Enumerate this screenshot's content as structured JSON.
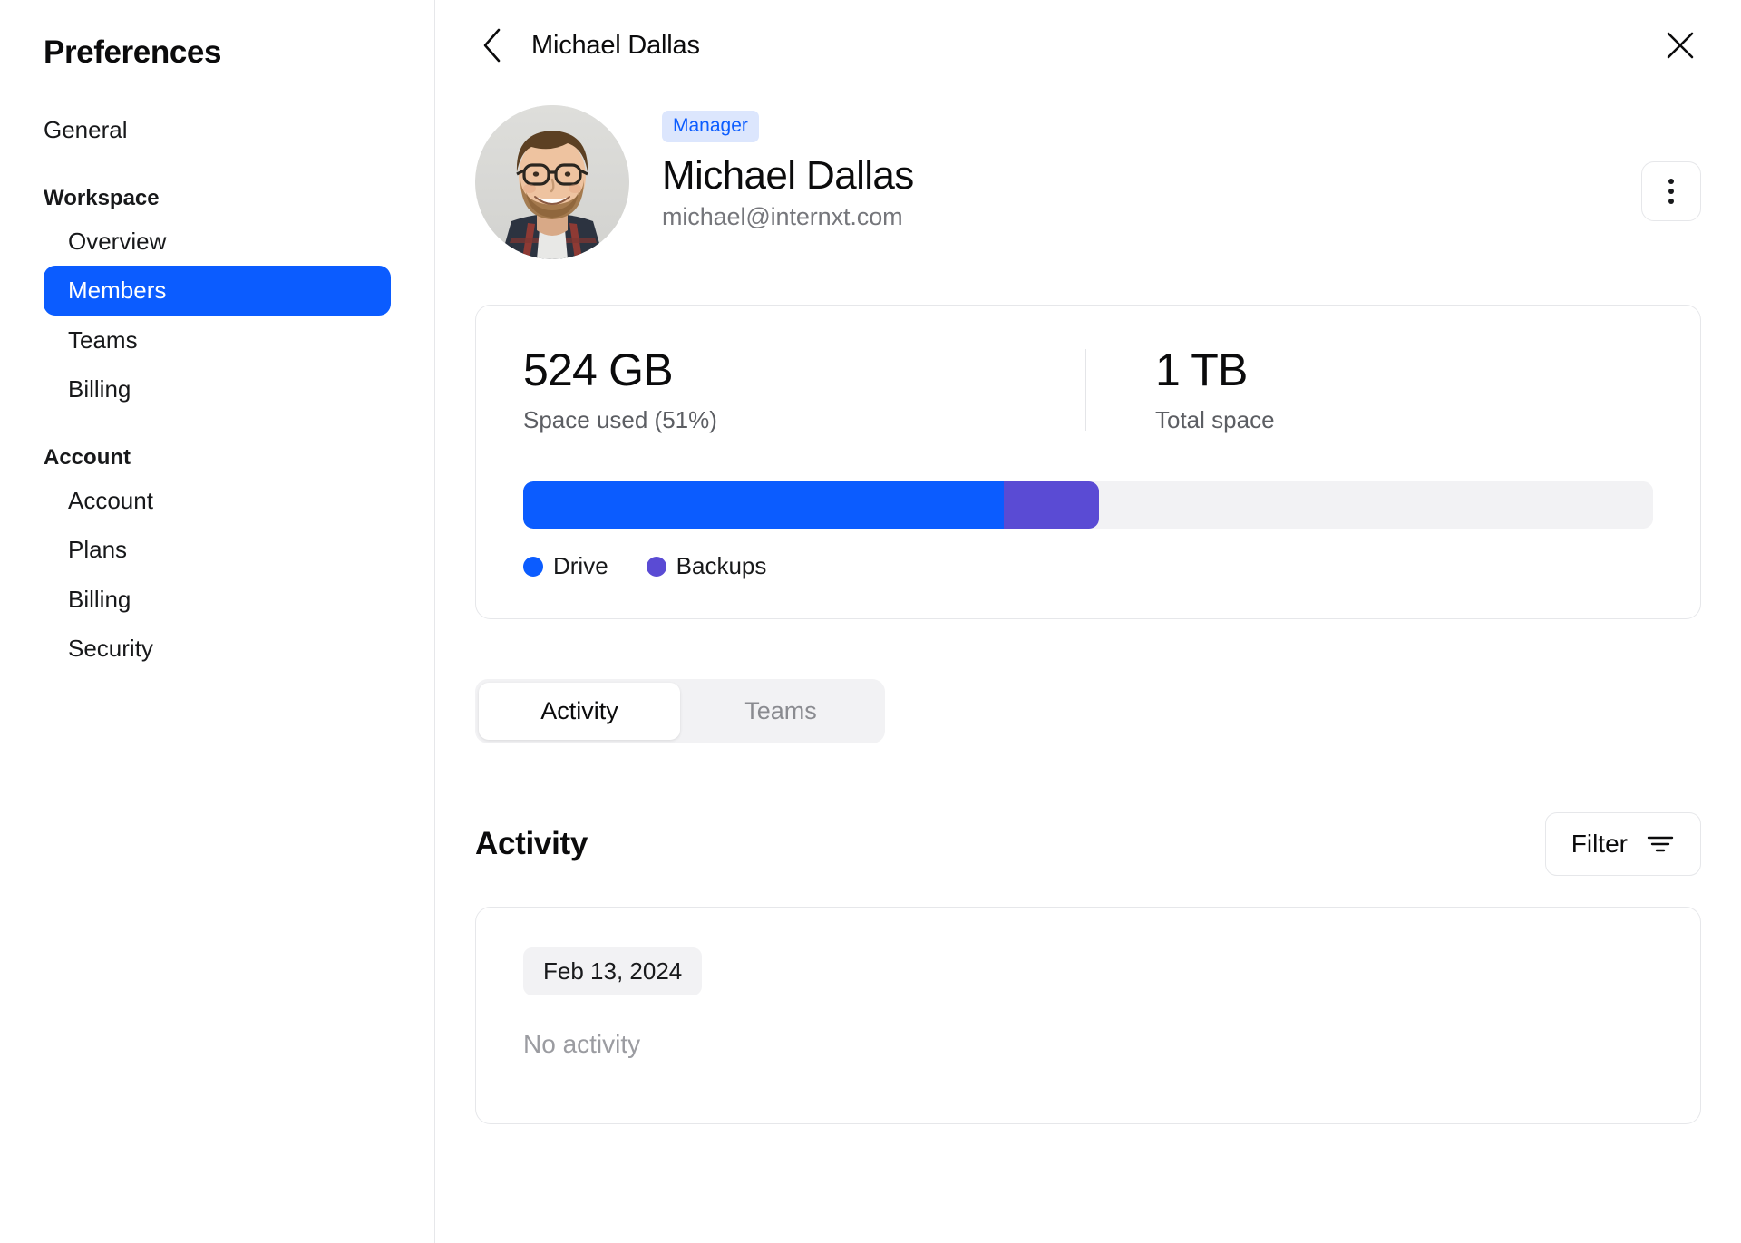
{
  "sidebar": {
    "title": "Preferences",
    "items": [
      {
        "label": "General",
        "type": "item",
        "selected": false
      },
      {
        "label": "Workspace",
        "type": "section"
      },
      {
        "label": "Overview",
        "type": "sub",
        "selected": false
      },
      {
        "label": "Members",
        "type": "sub",
        "selected": true
      },
      {
        "label": "Teams",
        "type": "sub",
        "selected": false
      },
      {
        "label": "Billing",
        "type": "sub",
        "selected": false
      },
      {
        "label": "Account",
        "type": "section"
      },
      {
        "label": "Account",
        "type": "sub",
        "selected": false
      },
      {
        "label": "Plans",
        "type": "sub",
        "selected": false
      },
      {
        "label": "Billing",
        "type": "sub",
        "selected": false
      },
      {
        "label": "Security",
        "type": "sub",
        "selected": false
      }
    ]
  },
  "topbar": {
    "title": "Michael Dallas",
    "back_icon": "chevron-left-icon",
    "close_icon": "close-icon"
  },
  "profile": {
    "role_badge": "Manager",
    "name": "Michael Dallas",
    "email": "michael@internxt.com",
    "avatar_alt": "Michael Dallas profile photo",
    "menu_icon": "kebab-menu-icon"
  },
  "storage": {
    "used_value": "524 GB",
    "used_label": "Space used (51%)",
    "total_value": "1 TB",
    "total_label": "Total space",
    "legend": [
      {
        "label": "Drive",
        "color": "#0B5CFF",
        "percent": 42.5
      },
      {
        "label": "Backups",
        "color": "#5A4BD4",
        "percent": 8.5
      }
    ],
    "track_color": "#F2F2F4",
    "used_percent": 51
  },
  "tabs": [
    {
      "label": "Activity",
      "selected": true
    },
    {
      "label": "Teams",
      "selected": false
    }
  ],
  "activity": {
    "heading": "Activity",
    "filter_label": "Filter",
    "filter_icon": "filter-icon",
    "date_chip": "Feb 13, 2024",
    "empty_text": "No activity"
  },
  "colors": {
    "accent": "#0B5CFF",
    "backups": "#5A4BD4",
    "badge_bg": "#DCE6FD",
    "border": "#E6E7EA",
    "muted": "#75767B"
  }
}
